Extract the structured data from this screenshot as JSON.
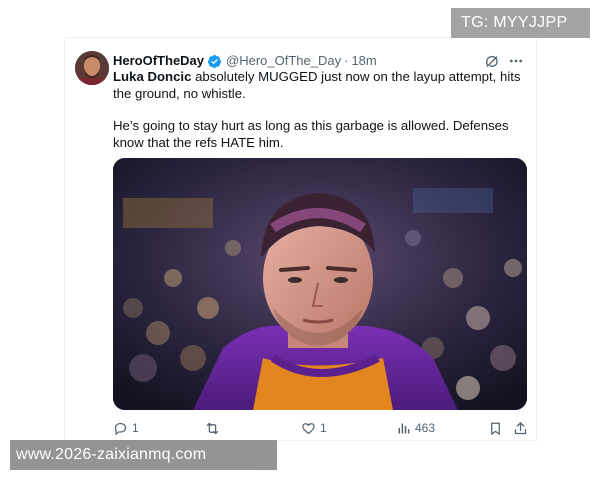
{
  "tweet": {
    "display_name": "HeroOfTheDay",
    "handle": "@Hero_OfThe_Day",
    "separator": "·",
    "time": "18m",
    "mention": "Luka Doncic",
    "paragraph1_rest": " absolutely MUGGED just now on the layup attempt, hits the ground, no whistle.",
    "paragraph2": "He’s going to stay hurt as long as this garbage is allowed. Defenses know that the refs HATE him.",
    "media_icon": "photo",
    "verified_color": "#1d9bf0"
  },
  "actions": {
    "reply_count": "1",
    "repost_count": "",
    "like_count": "1",
    "views_count": "463"
  },
  "icons": {
    "header": [
      "verified-icon",
      "grok-icon",
      "more-icon"
    ],
    "actions": [
      "reply-icon",
      "repost-icon",
      "like-icon",
      "views-icon",
      "bookmark-icon",
      "share-icon"
    ]
  },
  "overlays": {
    "top_right": "TG: MYYJJPP",
    "bottom_left": "www.2026-zaixianmq.com"
  }
}
